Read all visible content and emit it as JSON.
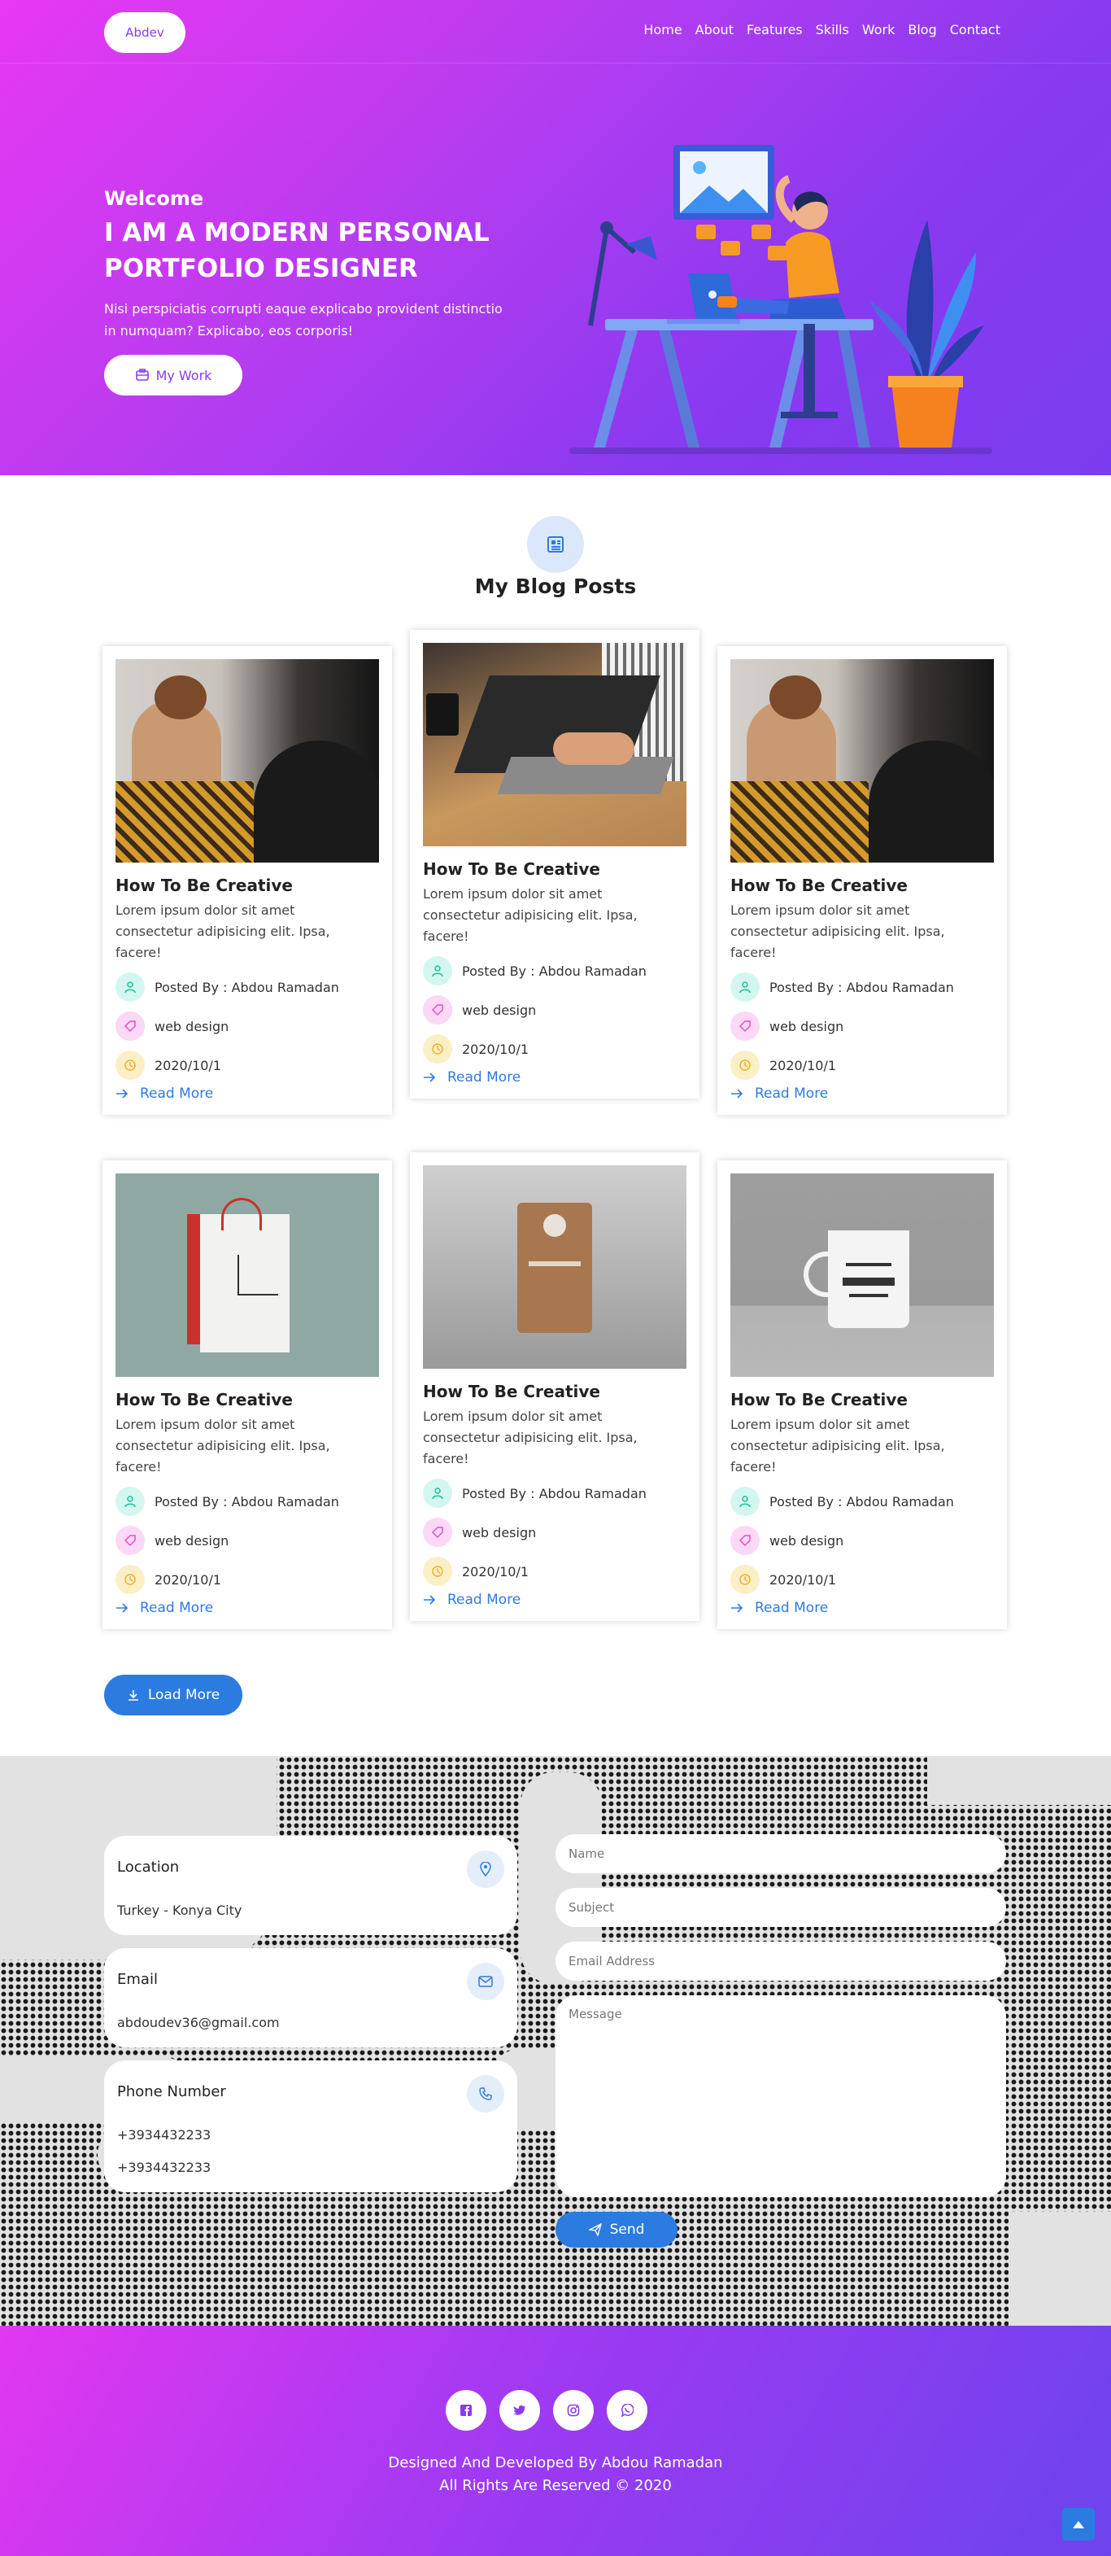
{
  "nav": {
    "logo": "Abdev",
    "links": [
      "Home",
      "About",
      "Features",
      "Skills",
      "Work",
      "Blog",
      "Contact"
    ]
  },
  "hero": {
    "welcome": "Welcome",
    "title_line1": "I AM A MODERN PERSONAL",
    "title_line2": "PORTFOLIO DESIGNER",
    "desc_line1": "Nisi perspiciatis corrupti eaque explicabo provident distinctio",
    "desc_line2": "in numquam? Explicabo, eos corporis!",
    "button": "My Work"
  },
  "blog": {
    "heading": "My Blog Posts",
    "cards": [
      {
        "title": "How To Be Creative",
        "text_line1": "Lorem ipsum dolor sit amet",
        "text_line2": "consectetur adipisicing elit. Ipsa,",
        "text_line3": "facere!",
        "author": "Posted By : Abdou Ramadan",
        "tag": "web design",
        "date": "2020/10/1",
        "read_more": "Read More",
        "image": "woman-portrait"
      },
      {
        "title": "How To Be Creative",
        "text_line1": "Lorem ipsum dolor sit amet",
        "text_line2": "consectetur adipisicing elit. Ipsa,",
        "text_line3": "facere!",
        "author": "Posted By : Abdou Ramadan",
        "tag": "web design",
        "date": "2020/10/1",
        "read_more": "Read More",
        "image": "laptop-typing"
      },
      {
        "title": "How To Be Creative",
        "text_line1": "Lorem ipsum dolor sit amet",
        "text_line2": "consectetur adipisicing elit. Ipsa,",
        "text_line3": "facere!",
        "author": "Posted By : Abdou Ramadan",
        "tag": "web design",
        "date": "2020/10/1",
        "read_more": "Read More",
        "image": "woman-portrait"
      },
      {
        "title": "How To Be Creative",
        "text_line1": "Lorem ipsum dolor sit amet",
        "text_line2": "consectetur adipisicing elit. Ipsa,",
        "text_line3": "facere!",
        "author": "Posted By : Abdou Ramadan",
        "tag": "web design",
        "date": "2020/10/1",
        "read_more": "Read More",
        "image": "bag-mockup"
      },
      {
        "title": "How To Be Creative",
        "text_line1": "Lorem ipsum dolor sit amet",
        "text_line2": "consectetur adipisicing elit. Ipsa,",
        "text_line3": "facere!",
        "author": "Posted By : Abdou Ramadan",
        "tag": "web design",
        "date": "2020/10/1",
        "read_more": "Read More",
        "image": "coffee-pouch"
      },
      {
        "title": "How To Be Creative",
        "text_line1": "Lorem ipsum dolor sit amet",
        "text_line2": "consectetur adipisicing elit. Ipsa,",
        "text_line3": "facere!",
        "author": "Posted By : Abdou Ramadan",
        "tag": "web design",
        "date": "2020/10/1",
        "read_more": "Read More",
        "image": "mug"
      }
    ],
    "load_more": "Load More"
  },
  "contact": {
    "location_label": "Location",
    "location_value": "Turkey - Konya City",
    "email_label": "Email",
    "email_value": "abdoudev36@gmail.com",
    "phone_label": "Phone Number",
    "phone_1": "+3934432233",
    "phone_2": "+3934432233",
    "form": {
      "name_placeholder": "Name",
      "subject_placeholder": "Subject",
      "email_placeholder": "Email Address",
      "message_placeholder": "Message",
      "send": "Send"
    }
  },
  "footer": {
    "line1": "Designed And Developed By Abdou Ramadan",
    "line2": "All Rights Are Reserved © 2020",
    "socials": [
      "facebook-icon",
      "twitter-icon",
      "instagram-icon",
      "whatsapp-icon"
    ]
  },
  "colors": {
    "brand_purple": "#8a3af0",
    "brand_pink": "#e838f2",
    "accent_blue": "#2b7be0"
  }
}
